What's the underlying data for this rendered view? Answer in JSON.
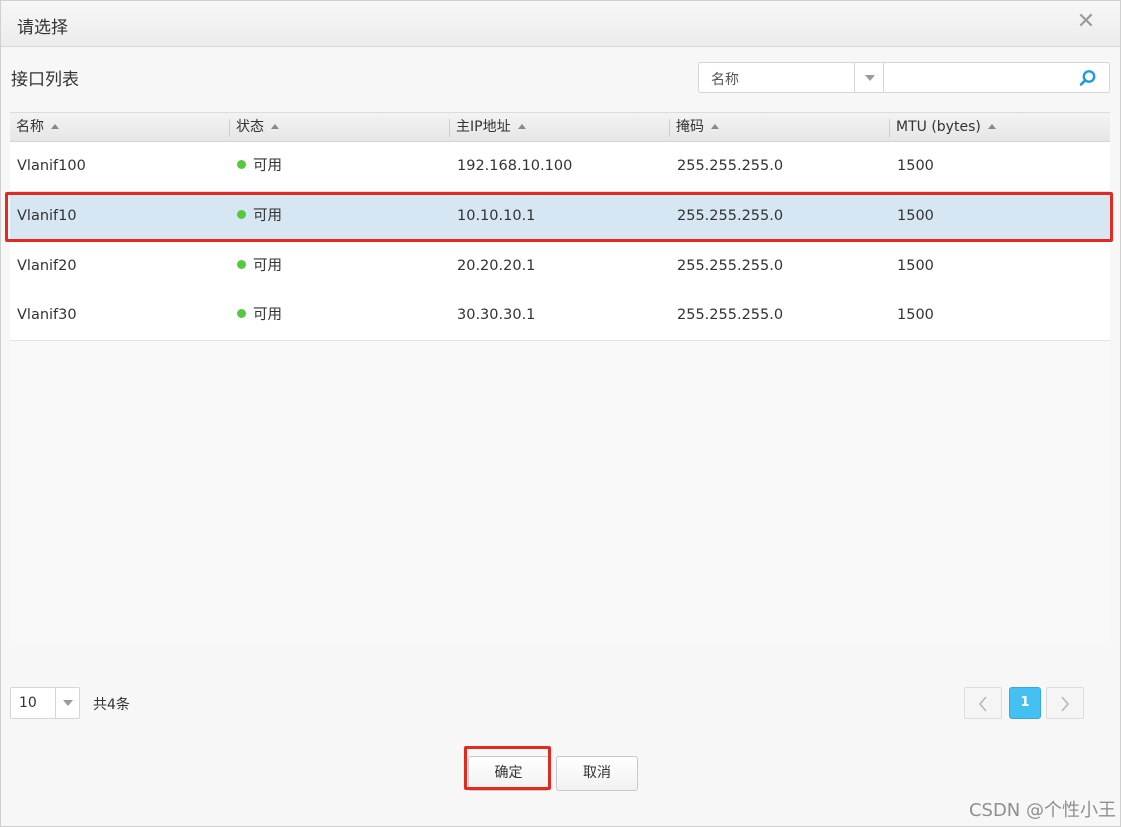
{
  "dialog": {
    "title": "请选择",
    "close_icon": "close-icon",
    "close_glyph": "✕"
  },
  "section_title": "接口列表",
  "search": {
    "field_label": "名称",
    "value": "",
    "placeholder": "",
    "icon": "search-icon"
  },
  "table": {
    "columns": [
      "名称",
      "状态",
      "主IP地址",
      "掩码",
      "MTU (bytes)"
    ],
    "rows": [
      {
        "name": "Vlanif100",
        "status": "可用",
        "ip": "192.168.10.100",
        "mask": "255.255.255.0",
        "mtu": "1500",
        "selected": false
      },
      {
        "name": "Vlanif10",
        "status": "可用",
        "ip": "10.10.10.1",
        "mask": "255.255.255.0",
        "mtu": "1500",
        "selected": true
      },
      {
        "name": "Vlanif20",
        "status": "可用",
        "ip": "20.20.20.1",
        "mask": "255.255.255.0",
        "mtu": "1500",
        "selected": false
      },
      {
        "name": "Vlanif30",
        "status": "可用",
        "ip": "30.30.30.1",
        "mask": "255.255.255.0",
        "mtu": "1500",
        "selected": false
      }
    ],
    "status_color": "#55c93f",
    "selected_row_color": "#d6e6f3",
    "highlight_color": "#e12a20"
  },
  "pagination": {
    "page_size": "10",
    "total_text": "共4条",
    "current_page": "1",
    "prev_icon": "chevron-left-icon",
    "next_icon": "chevron-right-icon",
    "accent": "#45c0f2"
  },
  "buttons": {
    "ok": "确定",
    "cancel": "取消"
  },
  "watermark": "CSDN @个性小王"
}
